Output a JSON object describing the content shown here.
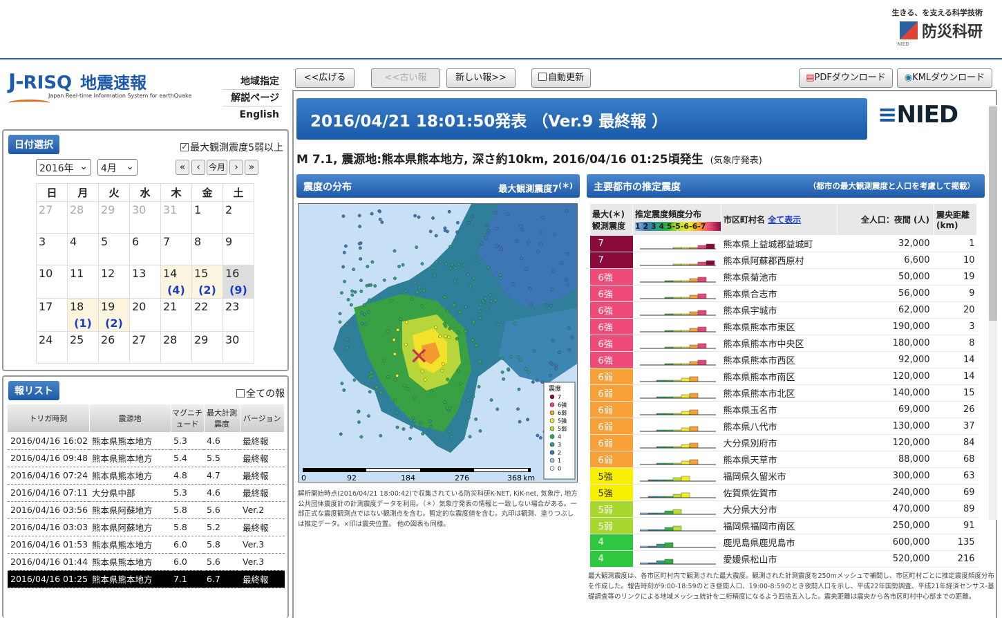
{
  "header": {
    "nied_tagline": "生きる、を支える科学技術",
    "nied_name": "防災科研",
    "nied_sub": "NIED",
    "logo_j": "J-",
    "logo_risq": "RISQ",
    "logo_title": "地震速報",
    "logo_sub": "Japan Real-time Information System for earthQuake"
  },
  "menu": [
    "地域指定",
    "解説ページ",
    "English"
  ],
  "toolbar": {
    "expand": "<<広げる",
    "older": "<<古い報",
    "newer": "新しい報>>",
    "auto_update": "自動更新",
    "pdf": "PDFダウンロード",
    "kml": "KMLダウンロード"
  },
  "date_panel": {
    "tab": "日付選択",
    "filter_label": "最大観測震度5弱以上",
    "year": "2016年",
    "month": "4月",
    "nav": [
      "«",
      "‹",
      "今月",
      "›",
      "»"
    ],
    "weekdays": [
      "日",
      "月",
      "火",
      "水",
      "木",
      "金",
      "土"
    ],
    "weeks": [
      [
        {
          "d": "27",
          "dim": true
        },
        {
          "d": "28",
          "dim": true
        },
        {
          "d": "29",
          "dim": true
        },
        {
          "d": "30",
          "dim": true
        },
        {
          "d": "31",
          "dim": true
        },
        {
          "d": "1"
        },
        {
          "d": "2"
        }
      ],
      [
        {
          "d": "3"
        },
        {
          "d": "4"
        },
        {
          "d": "5"
        },
        {
          "d": "6"
        },
        {
          "d": "7"
        },
        {
          "d": "8"
        },
        {
          "d": "9"
        }
      ],
      [
        {
          "d": "10"
        },
        {
          "d": "11"
        },
        {
          "d": "12"
        },
        {
          "d": "13"
        },
        {
          "d": "14",
          "n": "(4)"
        },
        {
          "d": "15",
          "n": "(2)"
        },
        {
          "d": "16",
          "n": "(9)",
          "sel": true
        }
      ],
      [
        {
          "d": "17"
        },
        {
          "d": "18",
          "n": "(1)"
        },
        {
          "d": "19",
          "n": "(2)"
        },
        {
          "d": "20"
        },
        {
          "d": "21"
        },
        {
          "d": "22"
        },
        {
          "d": "23"
        }
      ],
      [
        {
          "d": "24"
        },
        {
          "d": "25"
        },
        {
          "d": "26"
        },
        {
          "d": "27"
        },
        {
          "d": "28"
        },
        {
          "d": "29"
        },
        {
          "d": "30"
        }
      ]
    ]
  },
  "report_list": {
    "tab": "報リスト",
    "all_label": "全ての報",
    "headers": [
      "トリガ時刻",
      "震源地",
      "マグニチュード",
      "最大計測震度",
      "バージョン"
    ],
    "rows": [
      [
        "2016/04/16 16:02",
        "熊本県熊本地方",
        "5.3",
        "4.6",
        "最終報"
      ],
      [
        "2016/04/16 09:48",
        "熊本県熊本地方",
        "5.4",
        "5.5",
        "最終報"
      ],
      [
        "2016/04/16 07:24",
        "熊本県熊本地方",
        "4.8",
        "4.7",
        "最終報"
      ],
      [
        "2016/04/16 07:11",
        "大分県中部",
        "5.3",
        "4.6",
        "最終報"
      ],
      [
        "2016/04/16 03:56",
        "熊本県阿蘇地方",
        "5.8",
        "5.6",
        "Ver.2"
      ],
      [
        "2016/04/16 03:03",
        "熊本県阿蘇地方",
        "5.8",
        "5.2",
        "最終報"
      ],
      [
        "2016/04/16 01:53",
        "熊本県熊本地方",
        "6.0",
        "5.8",
        "Ver.3"
      ],
      [
        "2016/04/16 01:44",
        "熊本県熊本地方",
        "6.0",
        "5.6",
        "Ver.3"
      ],
      [
        "2016/04/16 01:25",
        "熊本県熊本地方",
        "7.1",
        "6.7",
        "最終報"
      ]
    ],
    "active_index": 8
  },
  "report": {
    "banner": "2016/04/21 18:01:50発表 （Ver.9 最終報 ）",
    "nied_logo": "NIED",
    "quake_info": "M 7.1, 震源地:熊本県熊本地方, 深さ約10km, 2016/04/16 01:25頃発生",
    "quake_source": "(気象庁発表)"
  },
  "map_section": {
    "title": "震度の分布",
    "max_label": "最大観測震度7",
    "max_note": "(＊)",
    "scale_ticks": [
      "0",
      "92",
      "184",
      "276",
      "368",
      "km"
    ],
    "legend_title": "震度",
    "legend": [
      {
        "label": "7",
        "color": "#8b0a3c"
      },
      {
        "label": "6強",
        "color": "#e8457a"
      },
      {
        "label": "6弱",
        "color": "#f7a030"
      },
      {
        "label": "5強",
        "color": "#f5ee20"
      },
      {
        "label": "5弱",
        "color": "#b8e030"
      },
      {
        "label": "4",
        "color": "#30b040"
      },
      {
        "label": "3",
        "color": "#2e9a8a"
      },
      {
        "label": "2",
        "color": "#3c78b8"
      },
      {
        "label": "1",
        "color": "#9fc4e6"
      },
      {
        "label": "0",
        "color": "#ffffff"
      }
    ],
    "note": "解析開始時点(2016/04/21 18:00:42)で収集されている防災科研K-NET, KiK-net, 気象庁, 地方公共団体震度計の計測震度データを利用。（＊）気象庁発表の情報と一致しない場合がある。一部正式な震度観測点ではない観測点を含む。暫定的な震度値を含む。丸印は観測、塗りつぶしは推定データ。×印は震央位置。 他の図表も同様。"
  },
  "city_section": {
    "title": "主要都市の推定震度",
    "subtitle": "（都市の最大観測震度と人口を考慮して掲載）",
    "headers": {
      "max_int": "最大(＊)観測震度",
      "dist_title": "推定震度頻度分布",
      "dist_scale": "1 2 3 4 5-5-6-6-7",
      "name": "市区町村名",
      "show_all": "全て表示",
      "pop": "全人口：夜間 (人)",
      "dist": "震央距離 (km)"
    },
    "rows": [
      {
        "int": "7",
        "color": "#8b0a3c",
        "name": "熊本県上益城郡益城町",
        "pop": "32,000",
        "dist": "1"
      },
      {
        "int": "7",
        "color": "#8b0a3c",
        "name": "熊本県阿蘇郡西原村",
        "pop": "6,600",
        "dist": "10"
      },
      {
        "int": "6強",
        "color": "#ef4b78",
        "name": "熊本県菊池市",
        "pop": "50,000",
        "dist": "19"
      },
      {
        "int": "6強",
        "color": "#ef4b78",
        "name": "熊本県合志市",
        "pop": "56,000",
        "dist": "9"
      },
      {
        "int": "6強",
        "color": "#ef4b78",
        "name": "熊本県宇城市",
        "pop": "62,000",
        "dist": "20"
      },
      {
        "int": "6強",
        "color": "#ef4b78",
        "name": "熊本県熊本市東区",
        "pop": "190,000",
        "dist": "3"
      },
      {
        "int": "6強",
        "color": "#ef4b78",
        "name": "熊本県熊本市中央区",
        "pop": "180,000",
        "dist": "8"
      },
      {
        "int": "6強",
        "color": "#ef4b78",
        "name": "熊本県熊本市西区",
        "pop": "92,000",
        "dist": "14"
      },
      {
        "int": "6弱",
        "color": "#f7a038",
        "name": "熊本県熊本市南区",
        "pop": "120,000",
        "dist": "14"
      },
      {
        "int": "6弱",
        "color": "#f7a038",
        "name": "熊本県熊本市北区",
        "pop": "140,000",
        "dist": "15"
      },
      {
        "int": "6弱",
        "color": "#f7a038",
        "name": "熊本県玉名市",
        "pop": "69,000",
        "dist": "26"
      },
      {
        "int": "6弱",
        "color": "#f7a038",
        "name": "熊本県八代市",
        "pop": "130,000",
        "dist": "37"
      },
      {
        "int": "6弱",
        "color": "#f7a038",
        "name": "大分県別府市",
        "pop": "120,000",
        "dist": "84"
      },
      {
        "int": "6弱",
        "color": "#f7a038",
        "name": "熊本県天草市",
        "pop": "88,000",
        "dist": "68"
      },
      {
        "int": "5強",
        "color": "#f7f000",
        "name": "福岡県久留米市",
        "pop": "300,000",
        "dist": "63"
      },
      {
        "int": "5強",
        "color": "#f7f000",
        "name": "佐賀県佐賀市",
        "pop": "240,000",
        "dist": "69"
      },
      {
        "int": "5弱",
        "color": "#a8d830",
        "name": "大分県大分市",
        "pop": "470,000",
        "dist": "89"
      },
      {
        "int": "5弱",
        "color": "#a8d830",
        "name": "福岡県福岡市南区",
        "pop": "250,000",
        "dist": "91"
      },
      {
        "int": "4",
        "color": "#2ec840",
        "name": "鹿児島県鹿児島市",
        "pop": "600,000",
        "dist": "135"
      },
      {
        "int": "4",
        "color": "#2ec840",
        "name": "愛媛県松山市",
        "pop": "520,000",
        "dist": "216"
      }
    ],
    "note": "最大観測震度は、各市区町村内で観測された最大震度。観測された計測震度を250mメッシュで補間し、市区町村ごとに推定震度頻度分布を作成した。報告時刻が9:00-18:59のとき昼間人口、19:00-8:59のとき夜間人口を示し、平成22年国勢調査、平成21年経済センサス-基礎調査等のリンクによる地域メッシュ統計を二桁精度になるよう四捨五入した。震央距離は震央から各市区町村中心部までの距離。"
  }
}
